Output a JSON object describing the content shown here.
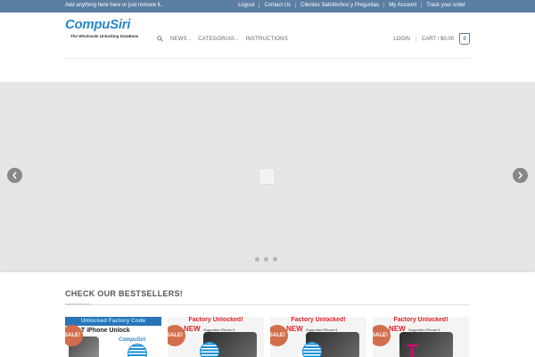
{
  "topbar": {
    "message": "Add anything here here or just remove it..",
    "links": [
      "Logout",
      "Contact Us",
      "Clientes Satisfechos y Preguntas",
      "My Account",
      "Track your order"
    ]
  },
  "logo": {
    "name": "CompuSiri",
    "tagline": "The Wholesale Unlocking DataBase"
  },
  "nav": {
    "items": [
      {
        "label": "NEWS",
        "has_dropdown": true
      },
      {
        "label": "CATEGORIAS",
        "has_dropdown": true
      },
      {
        "label": "INSTRUCTIONS",
        "has_dropdown": false
      }
    ]
  },
  "header_right": {
    "login": "LOGIN",
    "cart": "CART / $0.00",
    "cart_count": "0"
  },
  "slider": {
    "dot_count": 3
  },
  "bestsellers": {
    "title": "CHECK OUR BESTSELLERS!",
    "products": [
      {
        "badge": "SALE!",
        "banner": "Unlocked Factory Code",
        "headline": "AT&T iPhone Unlock",
        "brand": "CompuSiri"
      },
      {
        "badge": "SALE!",
        "banner": "Factory Unlocked!",
        "new_label": "NEW",
        "supported": "Supported iPhone 6"
      },
      {
        "badge": "SALE!",
        "banner": "Factory Unlocked!",
        "new_label": "NEW",
        "supported": "Supported iPhone 6"
      },
      {
        "badge": "SALE!",
        "banner": "Factory Unlocked!",
        "new_label": "NEW",
        "supported": "Supported iPhone 6",
        "logo_text": "T"
      }
    ]
  },
  "colors": {
    "topbar": "#5b7fa3",
    "sale_badge": "#d26e4b",
    "slider_bg": "#e6e6e6"
  }
}
